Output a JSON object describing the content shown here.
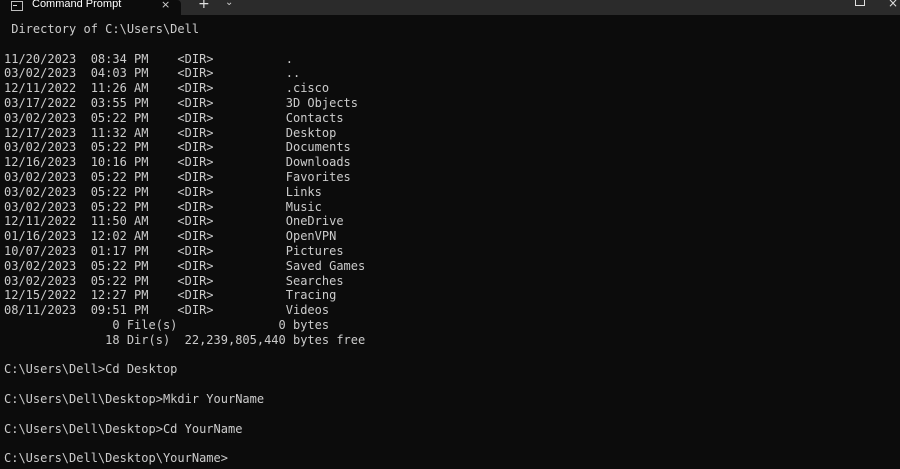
{
  "window": {
    "tab_title": "Command Prompt",
    "tab_close": "×",
    "new_tab": "+",
    "dropdown": "⌄",
    "close": "×"
  },
  "console": {
    "lines": [
      " Directory of C:\\Users\\Dell",
      "",
      "11/20/2023  08:34 PM    <DIR>          .",
      "03/02/2023  04:03 PM    <DIR>          ..",
      "12/11/2022  11:26 AM    <DIR>          .cisco",
      "03/17/2022  03:55 PM    <DIR>          3D Objects",
      "03/02/2023  05:22 PM    <DIR>          Contacts",
      "12/17/2023  11:32 AM    <DIR>          Desktop",
      "03/02/2023  05:22 PM    <DIR>          Documents",
      "12/16/2023  10:16 PM    <DIR>          Downloads",
      "03/02/2023  05:22 PM    <DIR>          Favorites",
      "03/02/2023  05:22 PM    <DIR>          Links",
      "03/02/2023  05:22 PM    <DIR>          Music",
      "12/11/2022  11:50 AM    <DIR>          OneDrive",
      "01/16/2023  12:02 AM    <DIR>          OpenVPN",
      "10/07/2023  01:17 PM    <DIR>          Pictures",
      "03/02/2023  05:22 PM    <DIR>          Saved Games",
      "03/02/2023  05:22 PM    <DIR>          Searches",
      "12/15/2022  12:27 PM    <DIR>          Tracing",
      "08/11/2023  09:51 PM    <DIR>          Videos",
      "               0 File(s)              0 bytes",
      "              18 Dir(s)  22,239,805,440 bytes free",
      "",
      "C:\\Users\\Dell>Cd Desktop",
      "",
      "C:\\Users\\Dell\\Desktop>Mkdir YourName",
      "",
      "C:\\Users\\Dell\\Desktop>Cd YourName",
      "",
      "C:\\Users\\Dell\\Desktop\\YourName>"
    ]
  }
}
